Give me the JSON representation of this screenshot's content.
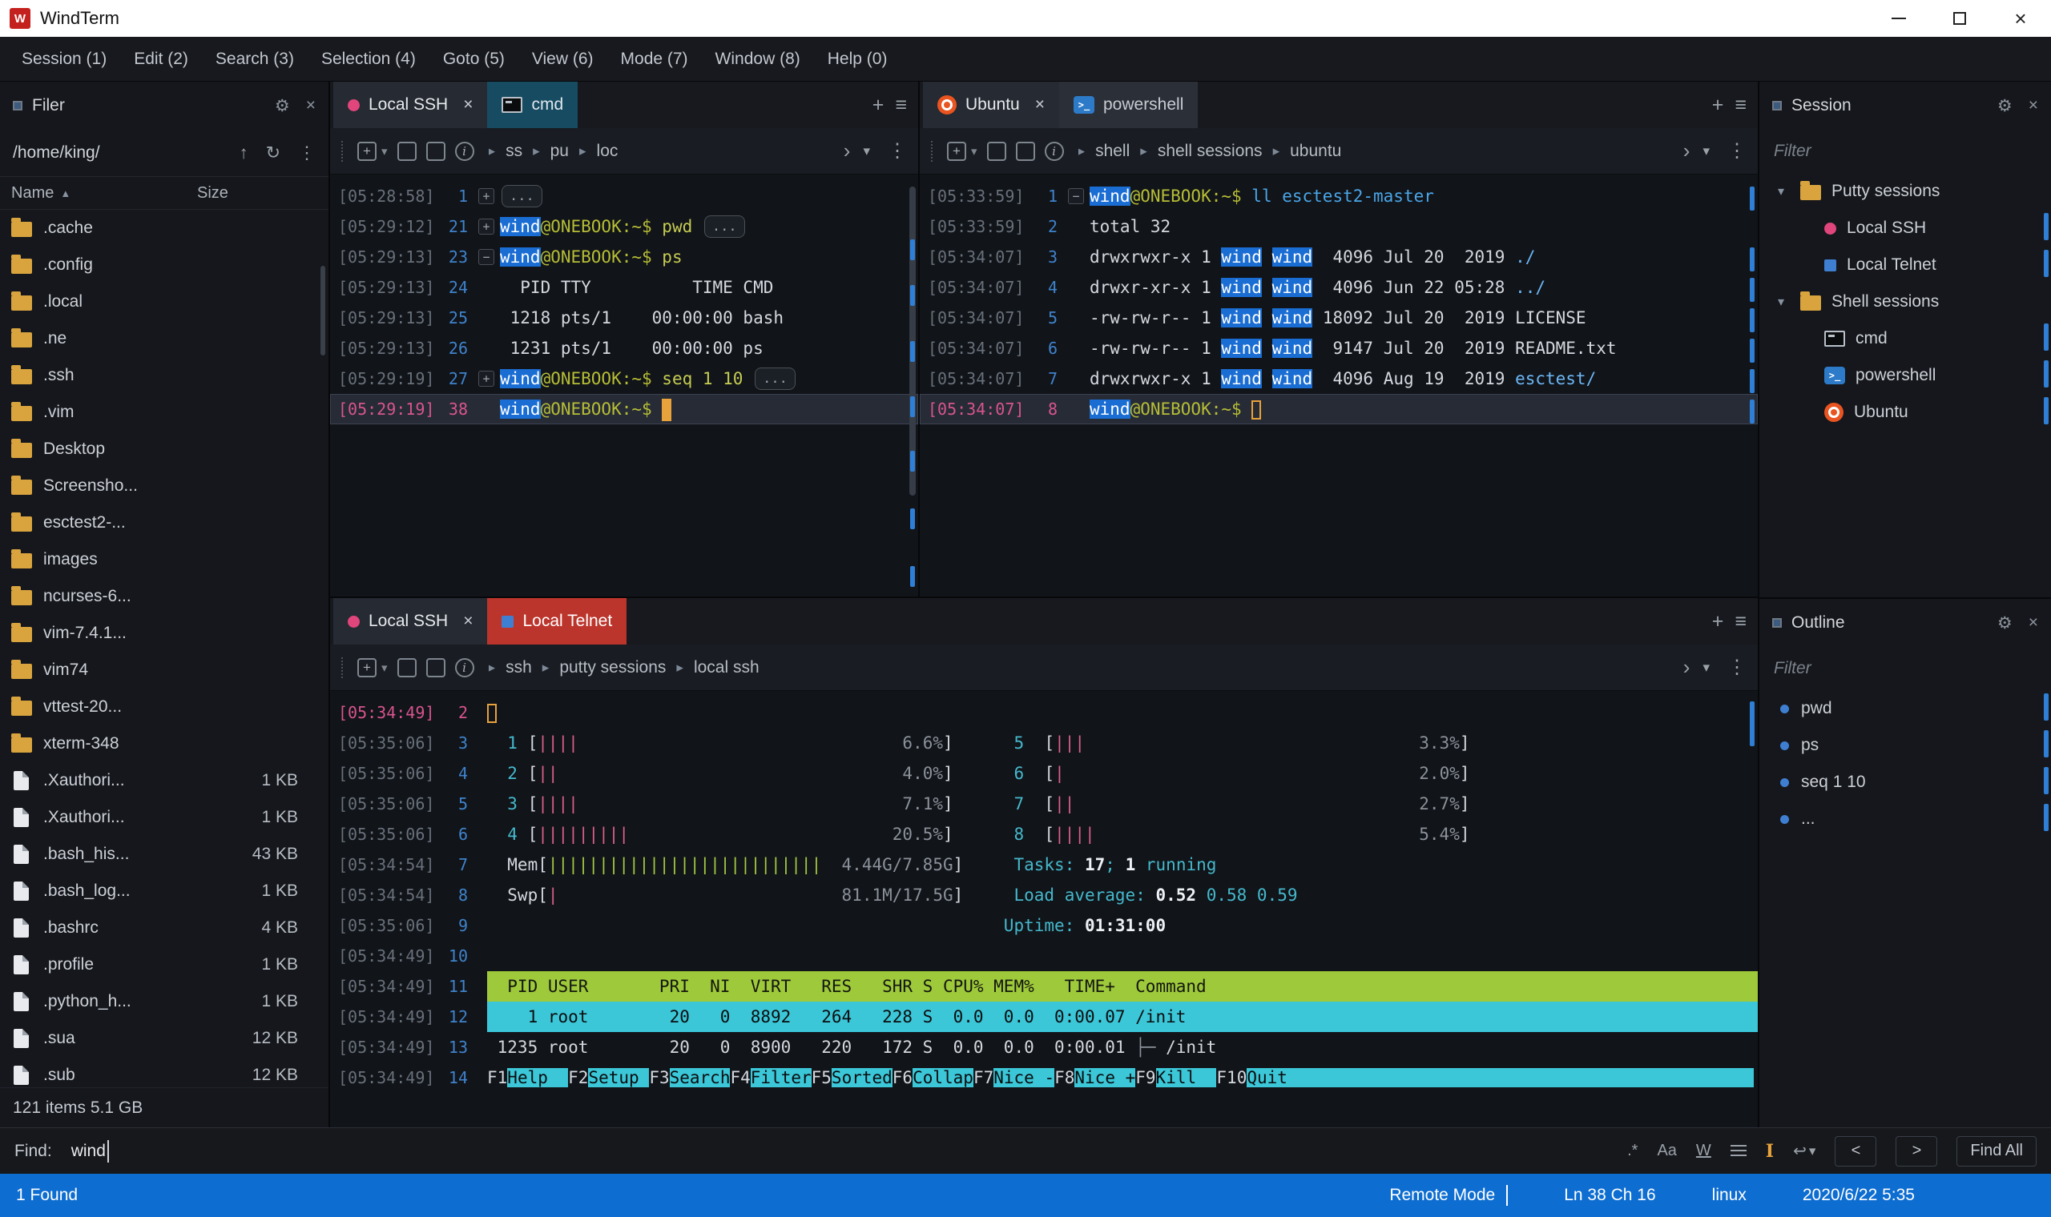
{
  "window": {
    "title": "WindTerm"
  },
  "menubar": {
    "items": [
      "Session (1)",
      "Edit (2)",
      "Search (3)",
      "Selection (4)",
      "Goto (5)",
      "View (6)",
      "Mode (7)",
      "Window (8)",
      "Help (0)"
    ]
  },
  "filer": {
    "title": "Filer",
    "path": "/home/king/",
    "columns": {
      "name": "Name",
      "size": "Size"
    },
    "rows": [
      {
        "icon": "folder",
        "name": ".cache",
        "size": ""
      },
      {
        "icon": "folder",
        "name": ".config",
        "size": ""
      },
      {
        "icon": "folder",
        "name": ".local",
        "size": ""
      },
      {
        "icon": "folder",
        "name": ".ne",
        "size": ""
      },
      {
        "icon": "folder",
        "name": ".ssh",
        "size": ""
      },
      {
        "icon": "folder",
        "name": ".vim",
        "size": ""
      },
      {
        "icon": "folder",
        "name": "Desktop",
        "size": ""
      },
      {
        "icon": "folder",
        "name": "Screensho...",
        "size": ""
      },
      {
        "icon": "folder",
        "name": "esctest2-...",
        "size": ""
      },
      {
        "icon": "folder",
        "name": "images",
        "size": ""
      },
      {
        "icon": "folder",
        "name": "ncurses-6...",
        "size": ""
      },
      {
        "icon": "folder",
        "name": "vim-7.4.1...",
        "size": ""
      },
      {
        "icon": "folder",
        "name": "vim74",
        "size": ""
      },
      {
        "icon": "folder",
        "name": "vttest-20...",
        "size": ""
      },
      {
        "icon": "folder",
        "name": "xterm-348",
        "size": ""
      },
      {
        "icon": "file",
        "name": ".Xauthori...",
        "size": "1 KB"
      },
      {
        "icon": "file",
        "name": ".Xauthori...",
        "size": "1 KB"
      },
      {
        "icon": "file",
        "name": ".bash_his...",
        "size": "43 KB"
      },
      {
        "icon": "file",
        "name": ".bash_log...",
        "size": "1 KB"
      },
      {
        "icon": "file",
        "name": ".bashrc",
        "size": "4 KB"
      },
      {
        "icon": "file",
        "name": ".profile",
        "size": "1 KB"
      },
      {
        "icon": "file",
        "name": ".python_h...",
        "size": "1 KB"
      },
      {
        "icon": "file",
        "name": ".sua",
        "size": "12 KB"
      },
      {
        "icon": "file",
        "name": ".sub",
        "size": "12 KB"
      }
    ],
    "footer": "121 items 5.1 GB"
  },
  "panes": {
    "topLeft": {
      "tabs": [
        {
          "icon": "dot",
          "label": "Local SSH",
          "active": true,
          "close": true
        },
        {
          "icon": "cmd",
          "label": "cmd",
          "style": "teal"
        }
      ],
      "breadcrumb": [
        "ss",
        "pu",
        "loc"
      ],
      "lines": [
        {
          "ts": "[05:28:58]",
          "n": "1",
          "fold": "+",
          "seg": [
            {
              "t": "...",
              "c": "pill"
            }
          ]
        },
        {
          "ts": "[05:29:12]",
          "n": "21",
          "fold": "+",
          "seg": [
            {
              "t": "wind",
              "c": "hl"
            },
            {
              "t": "@ONEBOOK:~$ ",
              "c": "pr"
            },
            {
              "t": "pwd ",
              "c": "cmdy"
            },
            {
              "t": "...",
              "c": "pill"
            }
          ]
        },
        {
          "ts": "[05:29:13]",
          "n": "23",
          "fold": "-",
          "seg": [
            {
              "t": "wind",
              "c": "hl"
            },
            {
              "t": "@ONEBOOK:~$ ",
              "c": "pr"
            },
            {
              "t": "ps",
              "c": "cmdy"
            }
          ]
        },
        {
          "ts": "[05:29:13]",
          "n": "24",
          "seg": [
            {
              "t": "  PID TTY          TIME CMD"
            }
          ]
        },
        {
          "ts": "[05:29:13]",
          "n": "25",
          "seg": [
            {
              "t": " 1218 pts/1    00:00:00 bash"
            }
          ]
        },
        {
          "ts": "[05:29:13]",
          "n": "26",
          "seg": [
            {
              "t": " 1231 pts/1    00:00:00 ps"
            }
          ]
        },
        {
          "ts": "[05:29:19]",
          "n": "27",
          "fold": "+",
          "seg": [
            {
              "t": "wind",
              "c": "hl"
            },
            {
              "t": "@ONEBOOK:~$ ",
              "c": "pr"
            },
            {
              "t": "seq 1 10 ",
              "c": "cmdy"
            },
            {
              "t": "...",
              "c": "pill"
            }
          ]
        },
        {
          "ts": "[05:29:19]",
          "n": "38",
          "cur": "full",
          "seg": [
            {
              "t": "wind",
              "c": "hl"
            },
            {
              "t": "@ONEBOOK:~$ ",
              "c": "pr"
            },
            {
              "c": "cursor"
            }
          ]
        }
      ]
    },
    "topRight": {
      "tabs": [
        {
          "icon": "ubuntu",
          "label": "Ubuntu",
          "active": true,
          "close": true
        },
        {
          "icon": "ps",
          "label": "powershell",
          "style": "light"
        }
      ],
      "breadcrumb": [
        "shell",
        "shell sessions",
        "ubuntu"
      ],
      "lines": [
        {
          "ts": "[05:33:59]",
          "n": "1",
          "fold": "-",
          "seg": [
            {
              "t": "wind",
              "c": "hl"
            },
            {
              "t": "@ONEBOOK:~$ ",
              "c": "pr"
            },
            {
              "t": "ll esctest2-master",
              "c": "cmdb"
            }
          ]
        },
        {
          "ts": "[05:33:59]",
          "n": "2",
          "seg": [
            {
              "t": "total 32"
            }
          ]
        },
        {
          "ts": "[05:34:07]",
          "n": "3",
          "seg": [
            {
              "t": "drwxrwxr-x 1 "
            },
            {
              "t": "wind",
              "c": "hl"
            },
            {
              "t": " "
            },
            {
              "t": "wind",
              "c": "hl"
            },
            {
              "t": "  4096 Jul 20  2019 "
            },
            {
              "t": "./",
              "c": "dir"
            }
          ]
        },
        {
          "ts": "[05:34:07]",
          "n": "4",
          "seg": [
            {
              "t": "drwxr-xr-x 1 "
            },
            {
              "t": "wind",
              "c": "hl"
            },
            {
              "t": " "
            },
            {
              "t": "wind",
              "c": "hl"
            },
            {
              "t": "  4096 Jun 22 05:28 "
            },
            {
              "t": "../",
              "c": "dir"
            }
          ]
        },
        {
          "ts": "[05:34:07]",
          "n": "5",
          "seg": [
            {
              "t": "-rw-rw-r-- 1 "
            },
            {
              "t": "wind",
              "c": "hl"
            },
            {
              "t": " "
            },
            {
              "t": "wind",
              "c": "hl"
            },
            {
              "t": " 18092 Jul 20  2019 "
            },
            {
              "t": "LICENSE"
            }
          ]
        },
        {
          "ts": "[05:34:07]",
          "n": "6",
          "seg": [
            {
              "t": "-rw-rw-r-- 1 "
            },
            {
              "t": "wind",
              "c": "hl"
            },
            {
              "t": " "
            },
            {
              "t": "wind",
              "c": "hl"
            },
            {
              "t": "  9147 Jul 20  2019 "
            },
            {
              "t": "README.txt"
            }
          ]
        },
        {
          "ts": "[05:34:07]",
          "n": "7",
          "seg": [
            {
              "t": "drwxrwxr-x 1 "
            },
            {
              "t": "wind",
              "c": "hl"
            },
            {
              "t": " "
            },
            {
              "t": "wind",
              "c": "hl"
            },
            {
              "t": "  4096 Aug 19  2019 "
            },
            {
              "t": "esctest/",
              "c": "dir"
            }
          ]
        },
        {
          "ts": "[05:34:07]",
          "n": "8",
          "cur": "full",
          "seg": [
            {
              "t": "wind",
              "c": "hl"
            },
            {
              "t": "@ONEBOOK:~$ ",
              "c": "pr"
            },
            {
              "c": "curh"
            }
          ]
        }
      ]
    },
    "bottom": {
      "tabs": [
        {
          "icon": "dot",
          "label": "Local SSH",
          "active": true,
          "close": true
        },
        {
          "icon": "square-blue",
          "label": "Local Telnet",
          "style": "alert"
        }
      ],
      "breadcrumb": [
        "ssh",
        "putty sessions",
        "local ssh"
      ],
      "lines": [
        {
          "ts": "[05:34:49]",
          "n": "2",
          "cur": "mark",
          "seg": [
            {
              "c": "curh"
            }
          ]
        },
        {
          "ts": "[05:35:06]",
          "n": "3",
          "seg": [
            {
              "t": "  "
            },
            {
              "t": "1",
              "c": "cyan"
            },
            {
              "t": " ["
            },
            {
              "t": "||||",
              "c": "meter"
            },
            {
              "sp": 32
            },
            {
              "t": "6.6%",
              "c": "dim"
            },
            {
              "t": "]"
            },
            {
              "sp": 6
            },
            {
              "t": "5",
              "c": "cyan"
            },
            {
              "t": "  ["
            },
            {
              "t": "|||",
              "c": "meter"
            },
            {
              "sp": 33
            },
            {
              "t": "3.3%",
              "c": "dim"
            },
            {
              "t": "]"
            }
          ]
        },
        {
          "ts": "[05:35:06]",
          "n": "4",
          "seg": [
            {
              "t": "  "
            },
            {
              "t": "2",
              "c": "cyan"
            },
            {
              "t": " ["
            },
            {
              "t": "||",
              "c": "meter"
            },
            {
              "sp": 34
            },
            {
              "t": "4.0%",
              "c": "dim"
            },
            {
              "t": "]"
            },
            {
              "sp": 6
            },
            {
              "t": "6",
              "c": "cyan"
            },
            {
              "t": "  ["
            },
            {
              "t": "|",
              "c": "meter"
            },
            {
              "sp": 35
            },
            {
              "t": "2.0%",
              "c": "dim"
            },
            {
              "t": "]"
            }
          ]
        },
        {
          "ts": "[05:35:06]",
          "n": "5",
          "seg": [
            {
              "t": "  "
            },
            {
              "t": "3",
              "c": "cyan"
            },
            {
              "t": " ["
            },
            {
              "t": "||||",
              "c": "meter"
            },
            {
              "sp": 32
            },
            {
              "t": "7.1%",
              "c": "dim"
            },
            {
              "t": "]"
            },
            {
              "sp": 6
            },
            {
              "t": "7",
              "c": "cyan"
            },
            {
              "t": "  ["
            },
            {
              "t": "||",
              "c": "meter"
            },
            {
              "sp": 34
            },
            {
              "t": "2.7%",
              "c": "dim"
            },
            {
              "t": "]"
            }
          ]
        },
        {
          "ts": "[05:35:06]",
          "n": "6",
          "seg": [
            {
              "t": "  "
            },
            {
              "t": "4",
              "c": "cyan"
            },
            {
              "t": " ["
            },
            {
              "t": "|||||||||",
              "c": "meter"
            },
            {
              "sp": 26
            },
            {
              "t": "20.5%",
              "c": "dim"
            },
            {
              "t": "]"
            },
            {
              "sp": 6
            },
            {
              "t": "8",
              "c": "cyan"
            },
            {
              "t": "  ["
            },
            {
              "t": "||||",
              "c": "meter"
            },
            {
              "sp": 32
            },
            {
              "t": "5.4%",
              "c": "dim"
            },
            {
              "t": "]"
            }
          ]
        },
        {
          "ts": "[05:34:54]",
          "n": "7",
          "seg": [
            {
              "t": "  Mem["
            },
            {
              "t": "|||||||||||||||||||||||||||",
              "c": "meterg"
            },
            {
              "sp": 2
            },
            {
              "t": "4.44G/7.85G",
              "c": "dim"
            },
            {
              "t": "]"
            },
            {
              "sp": 5
            },
            {
              "t": "Tasks: ",
              "c": "cyan"
            },
            {
              "t": "17",
              "c": "bold"
            },
            {
              "t": "; ",
              "c": "cyan"
            },
            {
              "t": "1",
              "c": "bold"
            },
            {
              "t": " running",
              "c": "cyan"
            }
          ]
        },
        {
          "ts": "[05:34:54]",
          "n": "8",
          "seg": [
            {
              "t": "  Swp["
            },
            {
              "t": "|",
              "c": "meter"
            },
            {
              "sp": 28
            },
            {
              "t": "81.1M/17.5G",
              "c": "dim"
            },
            {
              "t": "]"
            },
            {
              "sp": 5
            },
            {
              "t": "Load average: ",
              "c": "cyan"
            },
            {
              "t": "0.52 ",
              "c": "bold"
            },
            {
              "t": "0.58 0.59",
              "c": "cyan"
            }
          ]
        },
        {
          "ts": "[05:35:06]",
          "n": "9",
          "seg": [
            {
              "sp": 51
            },
            {
              "t": "Uptime: ",
              "c": "cyan"
            },
            {
              "t": "01:31:00",
              "c": "bold"
            }
          ]
        },
        {
          "ts": "[05:34:49]",
          "n": "10",
          "seg": []
        },
        {
          "ts": "[05:34:49]",
          "n": "11",
          "bar": "hdr",
          "seg": [
            {
              "t": "  PID USER       PRI  NI  VIRT   RES   SHR S CPU% MEM%   TIME+  Command"
            }
          ]
        },
        {
          "ts": "[05:34:49]",
          "n": "12",
          "bar": "sel",
          "seg": [
            {
              "t": "    1 root        20   0  8892   264   228 S  0.0  0.0  0:00.07 /init"
            }
          ]
        },
        {
          "ts": "[05:34:49]",
          "n": "13",
          "seg": [
            {
              "t": " 1235 root        20   0  8900   220   172 S  0.0  0.0  0:00.01 "
            },
            {
              "t": "├─ ",
              "c": "dim"
            },
            {
              "t": "/init"
            }
          ]
        },
        {
          "ts": "[05:34:49]",
          "n": "14",
          "seg": [
            {
              "t": "F1"
            },
            {
              "t": "Help  ",
              "c": "fk"
            },
            {
              "t": "F2"
            },
            {
              "t": "Setup ",
              "c": "fk"
            },
            {
              "t": "F3"
            },
            {
              "t": "Search",
              "c": "fk"
            },
            {
              "t": "F4"
            },
            {
              "t": "Filter",
              "c": "fk"
            },
            {
              "t": "F5"
            },
            {
              "t": "Sorted",
              "c": "fk"
            },
            {
              "t": "F6"
            },
            {
              "t": "Collap",
              "c": "fk"
            },
            {
              "t": "F7"
            },
            {
              "t": "Nice -",
              "c": "fk"
            },
            {
              "t": "F8"
            },
            {
              "t": "Nice +",
              "c": "fk"
            },
            {
              "t": "F9"
            },
            {
              "t": "Kill  ",
              "c": "fk"
            },
            {
              "t": "F10"
            },
            {
              "t": "Quit  ",
              "c": "fk"
            },
            {
              "sp": 44,
              "c": "fk"
            }
          ]
        }
      ]
    }
  },
  "session_panel": {
    "title": "Session",
    "filter": "Filter",
    "tree": [
      {
        "indent": 0,
        "chevron": true,
        "icon": "folder",
        "label": "Putty sessions"
      },
      {
        "indent": 1,
        "icon": "dot",
        "label": "Local SSH"
      },
      {
        "indent": 1,
        "icon": "square-blue",
        "label": "Local Telnet"
      },
      {
        "indent": 0,
        "chevron": true,
        "icon": "folder",
        "label": "Shell sessions"
      },
      {
        "indent": 1,
        "icon": "cmd",
        "label": "cmd"
      },
      {
        "indent": 1,
        "icon": "ps",
        "label": "powershell"
      },
      {
        "indent": 1,
        "icon": "ubuntu",
        "label": "Ubuntu"
      }
    ]
  },
  "outline_panel": {
    "title": "Outline",
    "filter": "Filter",
    "items": [
      "pwd",
      "ps",
      "seq 1 10",
      "..."
    ]
  },
  "findbar": {
    "label": "Find:",
    "value": "wind",
    "toggles": [
      ".*",
      "Aa",
      "W"
    ],
    "buttons": {
      "prev": "<",
      "next": ">",
      "find_all": "Find All"
    }
  },
  "statusbar": {
    "found": "1 Found",
    "mode": "Remote Mode",
    "position": "Ln 38 Ch 16",
    "encoding": "linux",
    "datetime": "2020/6/22 5:35"
  }
}
